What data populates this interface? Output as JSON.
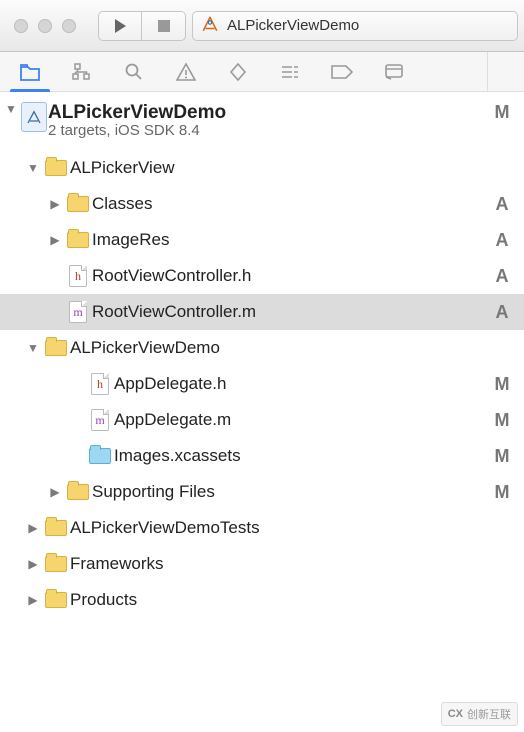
{
  "toolbar": {
    "scheme_name": "ALPickerViewDemo"
  },
  "project": {
    "name": "ALPickerViewDemo",
    "subtitle": "2 targets, iOS SDK 8.4",
    "status": "M"
  },
  "tree": [
    {
      "indent": 1,
      "disc": "down",
      "icon": "folder",
      "label": "ALPickerView",
      "status": ""
    },
    {
      "indent": 2,
      "disc": "right",
      "icon": "folder",
      "label": "Classes",
      "status": "A"
    },
    {
      "indent": 2,
      "disc": "right",
      "icon": "folder",
      "label": "ImageRes",
      "status": "A"
    },
    {
      "indent": 2,
      "disc": "",
      "icon": "file-h",
      "label": "RootViewController.h",
      "status": "A"
    },
    {
      "indent": 2,
      "disc": "",
      "icon": "file-m",
      "label": "RootViewController.m",
      "status": "A",
      "selected": true
    },
    {
      "indent": 1,
      "disc": "down",
      "icon": "folder",
      "label": "ALPickerViewDemo",
      "status": ""
    },
    {
      "indent": 3,
      "disc": "",
      "icon": "file-h",
      "label": "AppDelegate.h",
      "status": "M"
    },
    {
      "indent": 3,
      "disc": "",
      "icon": "file-m",
      "label": "AppDelegate.m",
      "status": "M"
    },
    {
      "indent": 3,
      "disc": "",
      "icon": "folder-blue",
      "label": "Images.xcassets",
      "status": "M"
    },
    {
      "indent": 2,
      "disc": "right",
      "icon": "folder",
      "label": "Supporting Files",
      "status": "M"
    },
    {
      "indent": 1,
      "disc": "right",
      "icon": "folder",
      "label": "ALPickerViewDemoTests",
      "status": ""
    },
    {
      "indent": 1,
      "disc": "right",
      "icon": "folder",
      "label": "Frameworks",
      "status": ""
    },
    {
      "indent": 1,
      "disc": "right",
      "icon": "folder",
      "label": "Products",
      "status": ""
    }
  ],
  "watermark": {
    "logo": "CX",
    "text": "创新互联"
  }
}
